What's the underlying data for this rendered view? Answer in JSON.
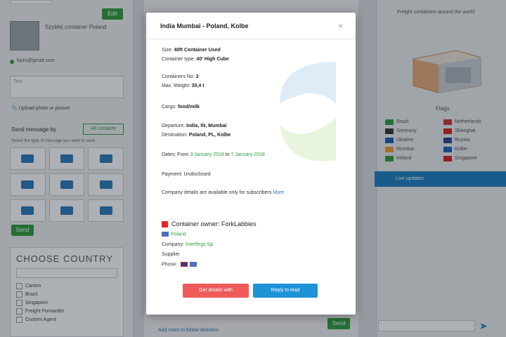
{
  "modal": {
    "title": "India Mumbai - Poland, Kolbe",
    "close_glyph": "×",
    "size_label": "Size",
    "size_value": "40ft Container Used",
    "container_type_label": "Container type",
    "container_type_value": "40' High Cube",
    "containers_label": "Containers No",
    "containers_value": "3",
    "weight_label": "Max. Weight",
    "weight_value": "30,4 t",
    "cargo_label": "Cargo",
    "cargo_value": "food/milk",
    "departure_label": "Departure",
    "departure_value": "India, IN, Mumbai",
    "destination_label": "Destination",
    "destination_value": "Poland, PL, Kolbe",
    "dates_prefix": "Dates: From",
    "date_from": "3 January 2018",
    "dates_mid": "to",
    "date_to": "7 January 2018",
    "status": "Payment: Undisclosed",
    "note_text": "Company details are available only for subscribers",
    "note_link": "More",
    "cancel_title": "Container owner: ForkLabbies",
    "country": "Poland",
    "company_label": "Company",
    "company_value": "Interflegs Sp",
    "supplier_label": "Supplier",
    "phone_label": "Phone",
    "btn_red": "Get details with",
    "btn_blue": "Reply to lead"
  },
  "left": {
    "top_btn": "Edit",
    "profile_name": "Szybkij container Poland",
    "email": "kpirs@gmail.com",
    "textarea_placeholder": "Text",
    "upload_label": "Upload photo or picture",
    "send_label": "Send message by",
    "send_toggle": "All contacts",
    "select_hint": "Select the type of message you want to send",
    "send_btn": "Send",
    "choose_title": "CHOOSE COUNTRY",
    "countries": [
      "Canton",
      "Brazil",
      "Singaporo",
      "Freight Forwarder",
      "Custom Agent"
    ]
  },
  "middle": {
    "bottom_link": "Add more to follow direction",
    "bottom_btn": "Send"
  },
  "right": {
    "map_title": "Freight containers around the world",
    "flags_title": "Flags",
    "flags": [
      {
        "name": "Brazil",
        "color": "#2e9b3d"
      },
      {
        "name": "Netherlands",
        "color": "#c23a3a"
      },
      {
        "name": "Germany",
        "color": "#333333"
      },
      {
        "name": "Shanghai",
        "color": "#d22222"
      },
      {
        "name": "Ukraine",
        "color": "#1d5fb5"
      },
      {
        "name": "Russia",
        "color": "#2c3e8f"
      },
      {
        "name": "Mumbai",
        "color": "#f09a33"
      },
      {
        "name": "Kolbe",
        "color": "#1d5fb5"
      },
      {
        "name": "Ireland",
        "color": "#2e9b3d"
      },
      {
        "name": "Singapore",
        "color": "#d22222"
      }
    ],
    "bar_label": "Live updates"
  }
}
